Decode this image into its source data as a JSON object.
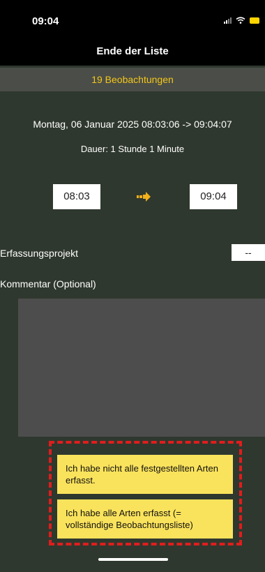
{
  "status_bar": {
    "time": "09:04",
    "battery_color": "#ffd500"
  },
  "header": {
    "title": "Ende der Liste"
  },
  "subheader": {
    "observations": "19 Beobachtungen",
    "accent_color": "#f2c71b"
  },
  "session": {
    "date_range": "Montag, 06 Januar 2025 08:03:06 -> 09:04:07",
    "duration": "Dauer: 1 Stunde 1 Minute",
    "start_time": "08:03",
    "end_time": "09:04",
    "arrow_icon": "arrow-right-icon"
  },
  "form": {
    "project_label": "Erfassungsprojekt",
    "project_value": "--",
    "comment_label": "Kommentar (Optional)",
    "comment_value": ""
  },
  "actions": {
    "incomplete_label": "Ich habe nicht alle festgestellten Arten erfasst.",
    "complete_label": "Ich habe alle Arten erfasst (= vollständige Beobachtungsliste)",
    "button_color": "#fae35c",
    "highlight_color": "#e01d1d"
  }
}
